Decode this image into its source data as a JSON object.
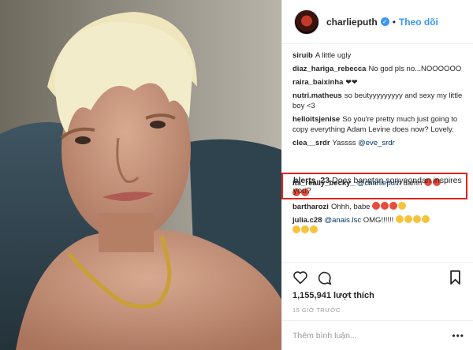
{
  "header": {
    "username": "charlieputh",
    "dot": "•",
    "follow_label": "Theo dõi"
  },
  "comments": [
    {
      "user": "siruib",
      "text": "A little ugly"
    },
    {
      "user": "diaz_hariga_rebecca",
      "text": "No god pls no...NOOOOOO"
    },
    {
      "user": "raira_baixinha",
      "text": "❤❤"
    },
    {
      "user": "nutri.matheus",
      "text": "so beutyyyyyyyyy and sexy my little boy <3"
    },
    {
      "user": "helloitsjenise",
      "text": "So you're pretty much just going to copy everything Adam Levine does now? Lovely."
    },
    {
      "user": "clea__srdr",
      "text": "Yassss",
      "mention": "@eve_srdr"
    },
    {
      "user": "blerts_23",
      "text": "Does bangtan sonyeondan inspires you?"
    },
    {
      "user": "its_really_becky_",
      "mention": "@charlieputh",
      "text": "damn"
    },
    {
      "user": "bartharozi",
      "text": "Ohhh, babe"
    },
    {
      "user": "julia.c28",
      "mention": "@anais.lsc",
      "text": "OMG!!!!!!"
    }
  ],
  "actions": {
    "like_icon": "heart-outline-icon",
    "comment_icon": "comment-bubble-icon",
    "save_icon": "bookmark-icon"
  },
  "likes": "1,155,941 lượt thích",
  "time": "15 GIỜ TRƯỚC",
  "add_comment_placeholder": "Thêm bình luận...",
  "more_label": "•••",
  "colors": {
    "accent": "#3897f0",
    "highlight": "#e2231a"
  }
}
